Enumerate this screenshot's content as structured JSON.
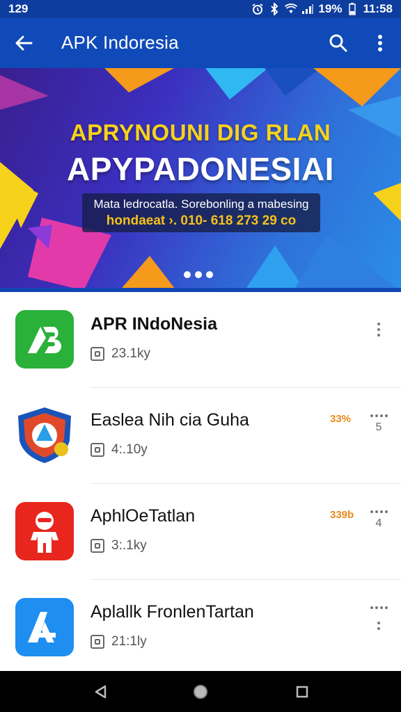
{
  "status_bar": {
    "time_left": "129",
    "battery_percent": "19%",
    "time_right": "11:58"
  },
  "app_bar": {
    "title": "APK Indoresia"
  },
  "banner": {
    "headline": "APRYNOUNI DIG RLAN",
    "title": "APYPADONESIAI",
    "line1": "Mata ledrocatla. Sorebonling a mabesing",
    "line2": "hondaeat ›. 010- 618 273 29 co"
  },
  "apps": [
    {
      "name": "APR INdoNesia",
      "meta": "23.1ky",
      "percent": "",
      "more_number": ""
    },
    {
      "name": "Easlea Nih cia Guha",
      "meta": "4:.10y",
      "percent": "33%",
      "more_number": "5"
    },
    {
      "name": "AphlOeTatlan",
      "meta": "3:.1ky",
      "percent": "339b",
      "more_number": "4"
    },
    {
      "name": "Aplallk FronlenTartan",
      "meta": "21:1ly",
      "percent": "",
      "more_number": ""
    }
  ],
  "colors": {
    "app_bar": "#0f4ab8",
    "status_bar": "#0d3d9e",
    "accent_orange": "#e8891c",
    "banner_yellow": "#f6d21a"
  },
  "icons": {
    "back": "arrow-back-icon",
    "search": "search-icon",
    "menu": "more-vert-icon",
    "nav_back": "nav-back-icon",
    "nav_home": "nav-home-icon",
    "nav_recents": "nav-recents-icon"
  }
}
